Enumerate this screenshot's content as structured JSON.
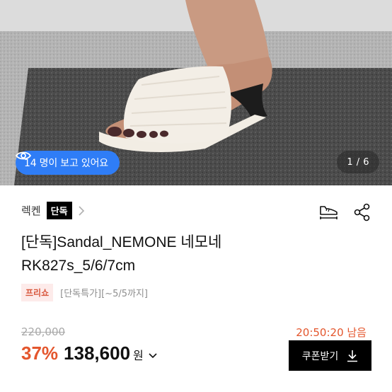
{
  "hero": {
    "viewers_text": "14 명이 보고 있어요",
    "page_counter": "1 / 6",
    "badge_color": "#2f7df6"
  },
  "product": {
    "brand_name": "렉켄",
    "brand_tag": "단독",
    "title_line1": "[단독]Sandal_NEMONE 네모네",
    "title_line2": "RK827s_5/6/7cm",
    "tag_label": "프리쇼",
    "tag_note": "[단독특가][~5/5까지]",
    "original_price": "220,000",
    "countdown": "20:50:20 남음",
    "discount": "37%",
    "price": "138,600",
    "currency": "원",
    "coupon_label": "쿠폰받기"
  },
  "colors": {
    "accent": "#e4562d",
    "button_bg": "#000000",
    "tag_bg": "#fdebea"
  },
  "icons": {
    "eye": "eye-icon",
    "chevron": "chevron-right-icon",
    "shoe_size": "shoe-size-icon",
    "share": "share-icon",
    "download": "download-icon"
  }
}
